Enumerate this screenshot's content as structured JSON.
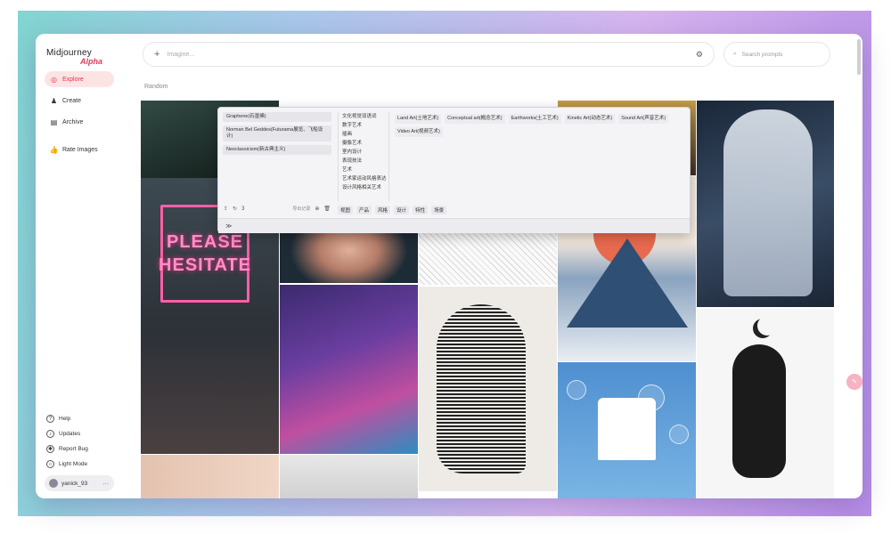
{
  "app": {
    "logo": "Midjourney",
    "logo_sub": "Alpha"
  },
  "sidebar": {
    "nav": [
      {
        "label": "Explore",
        "icon": "compass-icon",
        "active": true
      },
      {
        "label": "Create",
        "icon": "brush-icon",
        "active": false
      },
      {
        "label": "Archive",
        "icon": "archive-icon",
        "active": false
      },
      {
        "label": "Rate Images",
        "icon": "thumbs-up-icon",
        "active": false
      }
    ],
    "bottom": [
      {
        "label": "Help",
        "icon": "help-icon"
      },
      {
        "label": "Updates",
        "icon": "bell-icon"
      },
      {
        "label": "Report Bug",
        "icon": "bug-icon"
      },
      {
        "label": "Light Mode",
        "icon": "sun-icon"
      }
    ],
    "user": {
      "name": "yanick_93",
      "menu": "···"
    }
  },
  "topbar": {
    "imagine_placeholder": "Imagine...",
    "search_placeholder": "Search prompts"
  },
  "feed": {
    "sort_label": "Random"
  },
  "gallery": {
    "neon_line1": "PLEASE",
    "neon_line2": "HESITATE"
  },
  "panel": {
    "prompts": [
      "Graphene(石墨烯)",
      "Norman Bel Geddes(Futurama展览、飞船设计)",
      "Neoclassicism(新古典主义)"
    ],
    "tools_count": "3",
    "tools_label": "导出记录",
    "styles_list": [
      "文化视觉双语词",
      "数字艺术",
      "插画",
      "摄像艺术",
      "室内设计",
      "表现技法",
      "艺术",
      "艺术家运动风格表达",
      "设计风格相关艺术"
    ],
    "tags": [
      "Land Art(土地艺术)",
      "Conceptual art(概念艺术)",
      "Earthworks(土工艺术)",
      "Kinetic Art(动态艺术)",
      "Sound Art(声音艺术)",
      "Video Art(视频艺术)"
    ],
    "categories": [
      "视图",
      "产品",
      "风格",
      "设计",
      "特性",
      "场景"
    ],
    "footer": "≫"
  },
  "colors": {
    "accent": "#e0354e",
    "accent_bg": "#fde4e4"
  }
}
